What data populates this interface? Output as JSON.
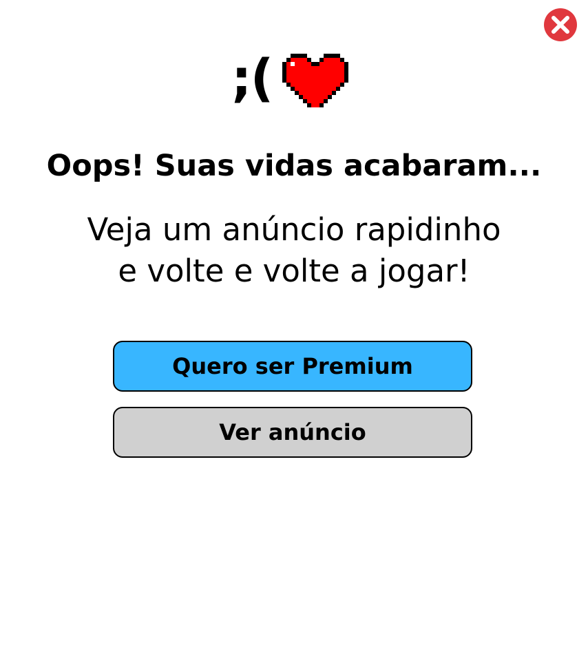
{
  "dialog": {
    "close_icon": "close-icon",
    "emoticon": ";(",
    "heart_icon": "pixel-heart-icon",
    "title": "Oops! Suas vidas acabaram...",
    "message_line1": "Veja um anúncio rapidinho",
    "message_line2": "e volte e volte a jogar!"
  },
  "buttons": {
    "premium_label": "Quero ser Premium",
    "ad_label": "Ver anúncio"
  },
  "colors": {
    "close": "#e0383e",
    "heart": "#ff0000",
    "premium_button": "#38b6ff",
    "ad_button": "#d0d0d0"
  }
}
